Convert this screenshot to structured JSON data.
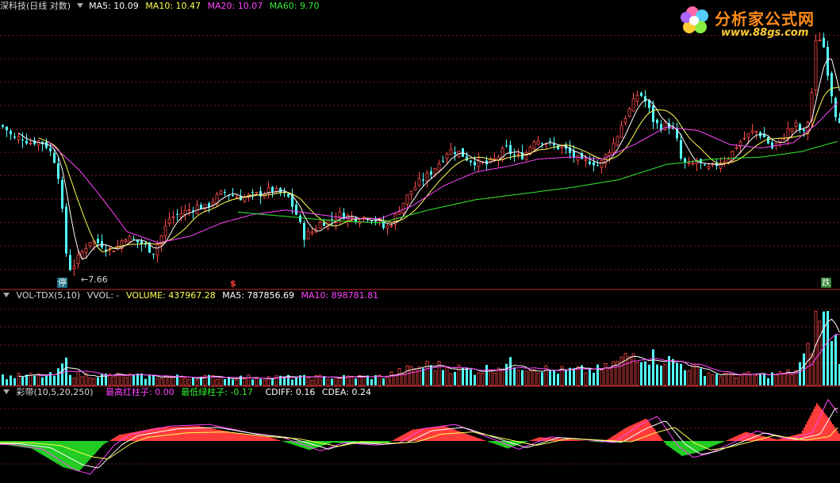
{
  "colors": {
    "up": "#ff4a4a",
    "down": "#54ffff",
    "ma5": "#ffffff",
    "ma10": "#ffff55",
    "ma20": "#ff44ff",
    "ma60": "#33ee33",
    "grid": "#a02020",
    "bg": "#000000",
    "cdiff": "#ffffff",
    "cdea": "#ffff55",
    "band_red": "#ff3c3c",
    "band_green": "#22cc22"
  },
  "price_header": {
    "title": "深科技(日线 对数)",
    "ma5": "MA5: 10.09",
    "ma10": "MA10: 10.47",
    "ma20": "MA20: 10.07",
    "ma60": "MA60: 9.70"
  },
  "vol_header": {
    "name": "VOL-TDX(5,10)",
    "vvol": "VVOL: -",
    "volume": "VOLUME: 437967.28",
    "ma5": "MA5: 787856.69",
    "ma10": "MA10: 898781.81"
  },
  "band_header": {
    "name": "彩带(10,5,20,250)",
    "max_red": "最高红柱子: 0.00",
    "min_green": "最低绿柱子: -0.17",
    "cdiff": "CDIFF: 0.16",
    "cdea": "CDEA: 0.24"
  },
  "markers": {
    "stop": "停",
    "low_price": "7.66",
    "dollar": "$",
    "fall": "跌"
  },
  "logo": {
    "text": "分析家公式网",
    "url": "www.88gs.com"
  },
  "chart_data": [
    {
      "type": "candlestick",
      "title": "深科技(日线 对数)",
      "y_scale": "log",
      "grid": true,
      "annotated_low": 7.66,
      "series": [
        {
          "name": "MA5",
          "last": 10.09
        },
        {
          "name": "MA10",
          "last": 10.47
        },
        {
          "name": "MA20",
          "last": 10.07
        },
        {
          "name": "MA60",
          "last": 9.7
        }
      ],
      "close_path": [
        [
          0,
          11.45
        ],
        [
          8,
          11.3
        ],
        [
          16,
          11.05
        ],
        [
          26,
          11.1
        ],
        [
          36,
          10.95
        ],
        [
          46,
          11.0
        ],
        [
          56,
          10.9
        ],
        [
          66,
          10.55
        ],
        [
          74,
          9.9
        ],
        [
          80,
          8.4
        ],
        [
          86,
          7.9
        ],
        [
          92,
          8.0
        ],
        [
          100,
          8.2
        ],
        [
          112,
          8.5
        ],
        [
          124,
          8.45
        ],
        [
          136,
          8.3
        ],
        [
          146,
          8.35
        ],
        [
          156,
          8.6
        ],
        [
          168,
          8.5
        ],
        [
          180,
          8.4
        ],
        [
          192,
          8.25
        ],
        [
          202,
          8.6
        ],
        [
          212,
          9.0
        ],
        [
          224,
          9.1
        ],
        [
          236,
          9.2
        ],
        [
          248,
          9.3
        ],
        [
          258,
          9.25
        ],
        [
          268,
          9.45
        ],
        [
          280,
          9.65
        ],
        [
          292,
          9.55
        ],
        [
          304,
          9.5
        ],
        [
          316,
          9.55
        ],
        [
          328,
          9.6
        ],
        [
          340,
          9.7
        ],
        [
          352,
          9.6
        ],
        [
          362,
          9.5
        ],
        [
          372,
          9.1
        ],
        [
          382,
          8.6
        ],
        [
          392,
          8.7
        ],
        [
          402,
          8.9
        ],
        [
          414,
          8.95
        ],
        [
          426,
          9.1
        ],
        [
          438,
          9.05
        ],
        [
          450,
          9.0
        ],
        [
          462,
          9.05
        ],
        [
          474,
          8.95
        ],
        [
          484,
          8.75
        ],
        [
          494,
          8.95
        ],
        [
          504,
          9.3
        ],
        [
          516,
          9.65
        ],
        [
          528,
          9.9
        ],
        [
          540,
          10.1
        ],
        [
          552,
          10.4
        ],
        [
          564,
          10.75
        ],
        [
          576,
          10.7
        ],
        [
          588,
          10.5
        ],
        [
          600,
          10.4
        ],
        [
          612,
          10.35
        ],
        [
          624,
          10.5
        ],
        [
          636,
          10.8
        ],
        [
          648,
          10.55
        ],
        [
          660,
          10.6
        ],
        [
          672,
          11.05
        ],
        [
          684,
          11.0
        ],
        [
          696,
          10.85
        ],
        [
          708,
          10.8
        ],
        [
          720,
          10.6
        ],
        [
          732,
          10.4
        ],
        [
          744,
          10.45
        ],
        [
          754,
          10.3
        ],
        [
          764,
          10.65
        ],
        [
          774,
          11.0
        ],
        [
          784,
          11.6
        ],
        [
          794,
          12.0
        ],
        [
          804,
          12.5
        ],
        [
          814,
          12.1
        ],
        [
          822,
          11.6
        ],
        [
          830,
          11.4
        ],
        [
          840,
          11.5
        ],
        [
          850,
          11.2
        ],
        [
          858,
          10.4
        ],
        [
          868,
          10.3
        ],
        [
          878,
          10.45
        ],
        [
          888,
          10.2
        ],
        [
          898,
          10.3
        ],
        [
          908,
          10.45
        ],
        [
          918,
          10.55
        ],
        [
          928,
          10.9
        ],
        [
          938,
          11.1
        ],
        [
          950,
          11.3
        ],
        [
          962,
          11.1
        ],
        [
          972,
          10.8
        ],
        [
          982,
          11.0
        ],
        [
          992,
          11.3
        ],
        [
          1002,
          11.45
        ],
        [
          1012,
          11.2
        ],
        [
          1020,
          11.8
        ],
        [
          1028,
          14.5
        ],
        [
          1036,
          14.2
        ],
        [
          1044,
          12.8
        ],
        [
          1052,
          11.8
        ],
        [
          1058,
          11.6
        ]
      ],
      "ma20_path": [
        [
          60,
          11.0
        ],
        [
          100,
          10.2
        ],
        [
          140,
          9.2
        ],
        [
          160,
          8.7
        ],
        [
          200,
          8.45
        ],
        [
          240,
          8.6
        ],
        [
          280,
          8.9
        ],
        [
          320,
          9.1
        ],
        [
          360,
          9.2
        ],
        [
          400,
          9.1
        ],
        [
          440,
          9.0
        ],
        [
          480,
          9.0
        ],
        [
          520,
          9.3
        ],
        [
          560,
          9.8
        ],
        [
          600,
          10.15
        ],
        [
          640,
          10.3
        ],
        [
          680,
          10.5
        ],
        [
          720,
          10.55
        ],
        [
          760,
          10.5
        ],
        [
          800,
          10.9
        ],
        [
          840,
          11.4
        ],
        [
          880,
          11.3
        ],
        [
          920,
          10.9
        ],
        [
          960,
          10.8
        ],
        [
          1000,
          10.95
        ],
        [
          1030,
          11.5
        ],
        [
          1058,
          12.2
        ]
      ],
      "ma60_path": [
        [
          300,
          9.15
        ],
        [
          360,
          9.05
        ],
        [
          420,
          8.95
        ],
        [
          480,
          8.9
        ],
        [
          540,
          9.2
        ],
        [
          600,
          9.45
        ],
        [
          660,
          9.6
        ],
        [
          720,
          9.75
        ],
        [
          780,
          9.95
        ],
        [
          840,
          10.35
        ],
        [
          900,
          10.5
        ],
        [
          960,
          10.55
        ],
        [
          1010,
          10.7
        ],
        [
          1058,
          11.0
        ]
      ]
    },
    {
      "type": "bar",
      "title": "VOL-TDX(5,10)",
      "series": [
        {
          "name": "VOLUME",
          "last": 437967.28
        },
        {
          "name": "MA5",
          "last": 787856.69
        },
        {
          "name": "MA10",
          "last": 898781.81
        }
      ],
      "profile": [
        [
          0,
          0.12
        ],
        [
          70,
          0.14
        ],
        [
          80,
          0.35
        ],
        [
          90,
          0.15
        ],
        [
          200,
          0.12
        ],
        [
          300,
          0.11
        ],
        [
          400,
          0.11
        ],
        [
          480,
          0.12
        ],
        [
          500,
          0.18
        ],
        [
          540,
          0.28
        ],
        [
          600,
          0.2
        ],
        [
          640,
          0.3
        ],
        [
          700,
          0.2
        ],
        [
          760,
          0.22
        ],
        [
          800,
          0.45
        ],
        [
          840,
          0.35
        ],
        [
          900,
          0.15
        ],
        [
          960,
          0.14
        ],
        [
          1000,
          0.18
        ],
        [
          1020,
          0.5
        ],
        [
          1030,
          1.0
        ],
        [
          1045,
          0.85
        ],
        [
          1058,
          0.4
        ]
      ]
    },
    {
      "type": "area",
      "title": "彩带(10,5,20,250)",
      "series": [
        {
          "name": "最高红柱子",
          "last": 0.0
        },
        {
          "name": "最低绿柱子",
          "last": -0.17
        },
        {
          "name": "CDIFF",
          "last": 0.16
        },
        {
          "name": "CDEA",
          "last": 0.24
        }
      ],
      "band_path": [
        [
          0,
          -0.04
        ],
        [
          40,
          -0.1
        ],
        [
          80,
          -0.35
        ],
        [
          100,
          -0.4
        ],
        [
          130,
          -0.05
        ],
        [
          150,
          0.08
        ],
        [
          200,
          0.18
        ],
        [
          250,
          0.2
        ],
        [
          300,
          0.1
        ],
        [
          340,
          0.05
        ],
        [
          370,
          -0.05
        ],
        [
          390,
          -0.12
        ],
        [
          420,
          -0.02
        ],
        [
          460,
          -0.05
        ],
        [
          490,
          -0.02
        ],
        [
          520,
          0.15
        ],
        [
          560,
          0.2
        ],
        [
          600,
          0.05
        ],
        [
          640,
          -0.1
        ],
        [
          680,
          0.05
        ],
        [
          720,
          0.02
        ],
        [
          760,
          -0.02
        ],
        [
          790,
          0.18
        ],
        [
          815,
          0.3
        ],
        [
          840,
          -0.05
        ],
        [
          860,
          -0.2
        ],
        [
          880,
          -0.15
        ],
        [
          910,
          -0.02
        ],
        [
          940,
          0.12
        ],
        [
          980,
          0.02
        ],
        [
          1010,
          0.1
        ],
        [
          1030,
          0.5
        ],
        [
          1045,
          0.3
        ],
        [
          1058,
          0.1
        ]
      ]
    }
  ]
}
